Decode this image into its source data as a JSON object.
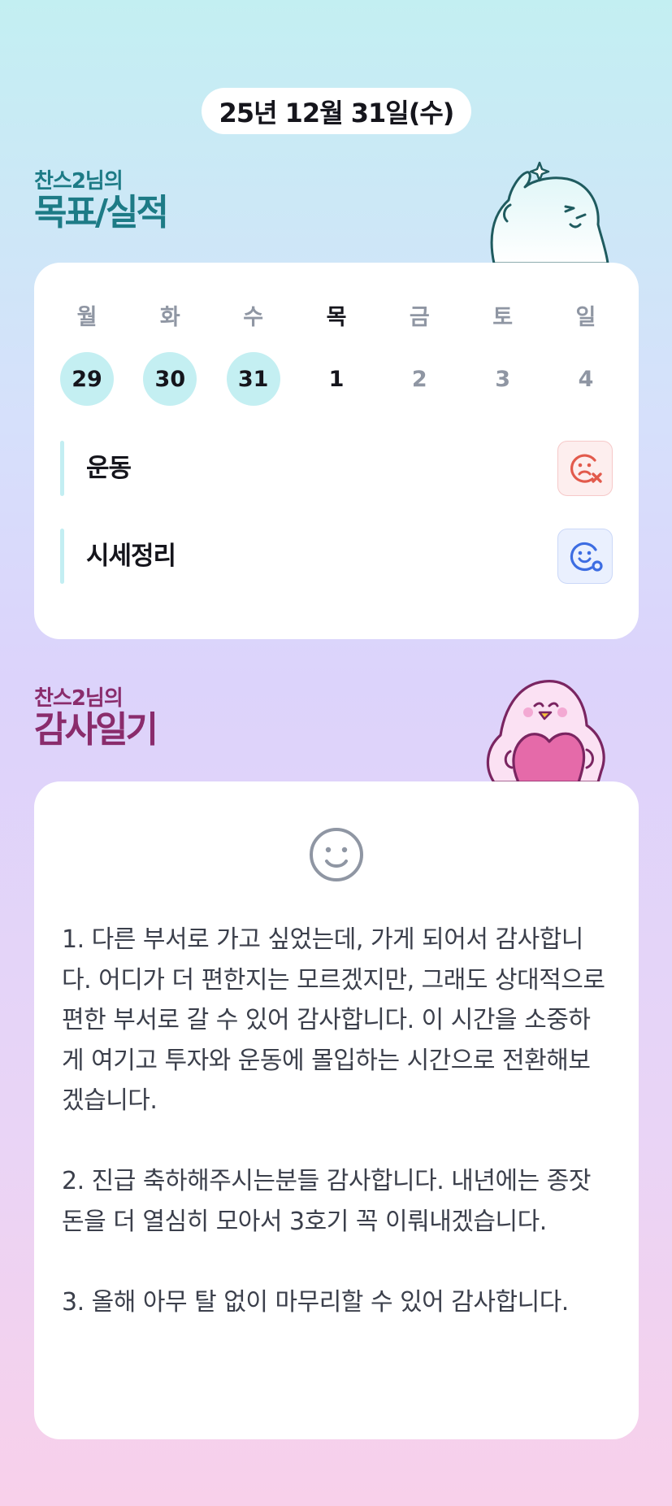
{
  "header": {
    "date": "25년 12월 31일(수)"
  },
  "goals_section": {
    "subtitle": "찬스2님의",
    "title": "목표/실적",
    "week": [
      {
        "dow": "월",
        "date": "29",
        "state": "done"
      },
      {
        "dow": "화",
        "date": "30",
        "state": "done"
      },
      {
        "dow": "수",
        "date": "31",
        "state": "done"
      },
      {
        "dow": "목",
        "date": "1",
        "state": "today"
      },
      {
        "dow": "금",
        "date": "2",
        "state": "future"
      },
      {
        "dow": "토",
        "date": "3",
        "state": "future"
      },
      {
        "dow": "일",
        "date": "4",
        "state": "future"
      }
    ],
    "goals": [
      {
        "label": "운동",
        "status": "fail",
        "icon": "sad-face-x-icon"
      },
      {
        "label": "시세정리",
        "status": "success",
        "icon": "smile-face-check-icon"
      }
    ]
  },
  "gratitude_section": {
    "subtitle": "찬스2님의",
    "title": "감사일기",
    "mood_icon": "smile-face-icon",
    "entries": [
      "1. 다른 부서로 가고 싶었는데, 가게 되어서 감사합니다. 어디가 더 편한지는 모르겠지만, 그래도 상대적으로 편한 부서로 갈 수 있어 감사합니다. 이 시간을 소중하게 여기고 투자와 운동에 몰입하는 시간으로 전환해보겠습니다.",
      "2. 진급 축하해주시는분들 감사합니다. 내년에는 종잣돈을 더 열심히 모아서 3호기 꼭 이뤄내겠습니다.",
      "3. 올해 아무 탈 없이 마무리할 수 있어 감사합니다."
    ]
  },
  "colors": {
    "goal_accent": "#1d7b86",
    "gratitude_accent": "#8a2c6c",
    "done_circle": "#c4eff2",
    "fail": "#e25a4c",
    "success": "#3d6de2"
  }
}
